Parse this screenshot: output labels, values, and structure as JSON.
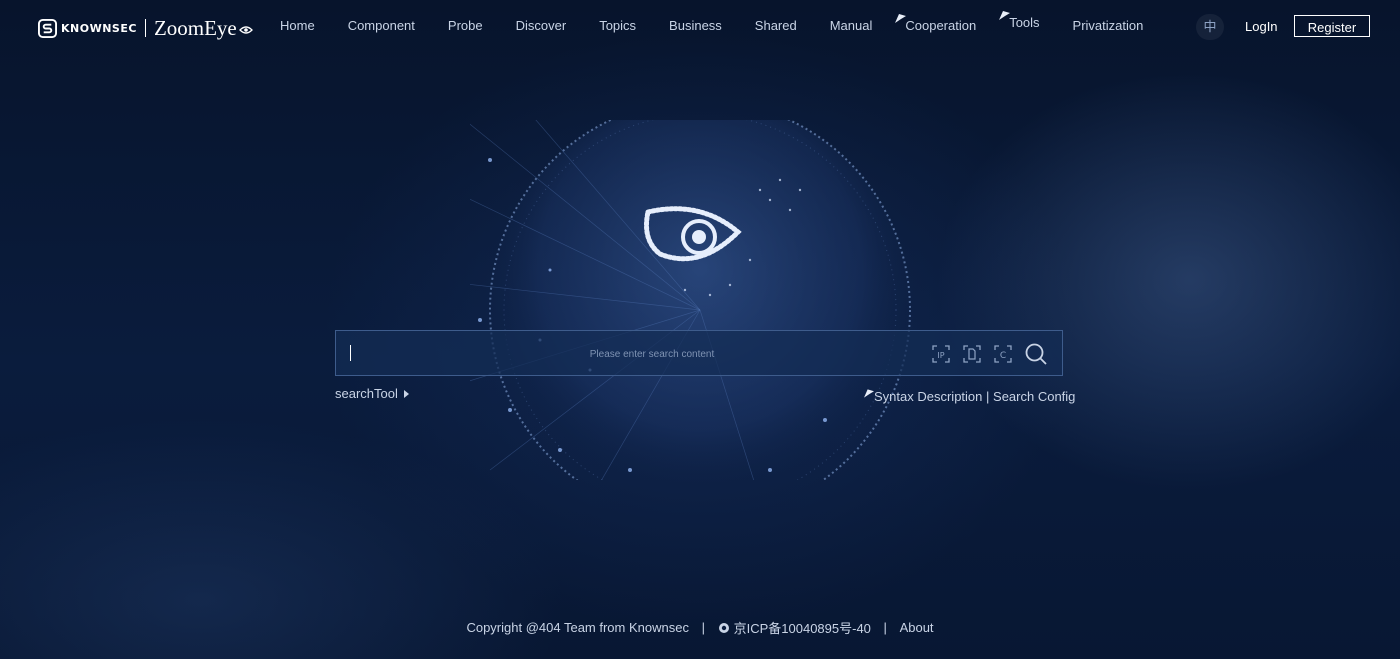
{
  "brand": {
    "company": "KNOWNSEC",
    "product": "ZoomEye"
  },
  "nav": {
    "items": [
      {
        "label": "Home"
      },
      {
        "label": "Component"
      },
      {
        "label": "Probe"
      },
      {
        "label": "Discover"
      },
      {
        "label": "Topics"
      },
      {
        "label": "Business"
      },
      {
        "label": "Shared"
      },
      {
        "label": "Manual"
      },
      {
        "label": "Cooperation"
      },
      {
        "label": "Tools"
      },
      {
        "label": "Privatization"
      }
    ],
    "lang": "中",
    "login": "LogIn",
    "register": "Register"
  },
  "search": {
    "placeholder": "Please enter search content",
    "value": "",
    "icons": [
      "ip-search-icon",
      "file-search-icon",
      "cert-search-icon",
      "search-icon"
    ],
    "tool_label": "searchTool",
    "syntax_label": "Syntax Description",
    "separator": "|",
    "config_label": "Search Config"
  },
  "footer": {
    "copyright": "Copyright @404 Team from Knownsec",
    "icp": "京ICP备10040895号-40",
    "about": "About",
    "separator": "|"
  },
  "colors": {
    "background": "#07142c",
    "text": "#c9d4e6",
    "accent": "#3e5c8c"
  }
}
